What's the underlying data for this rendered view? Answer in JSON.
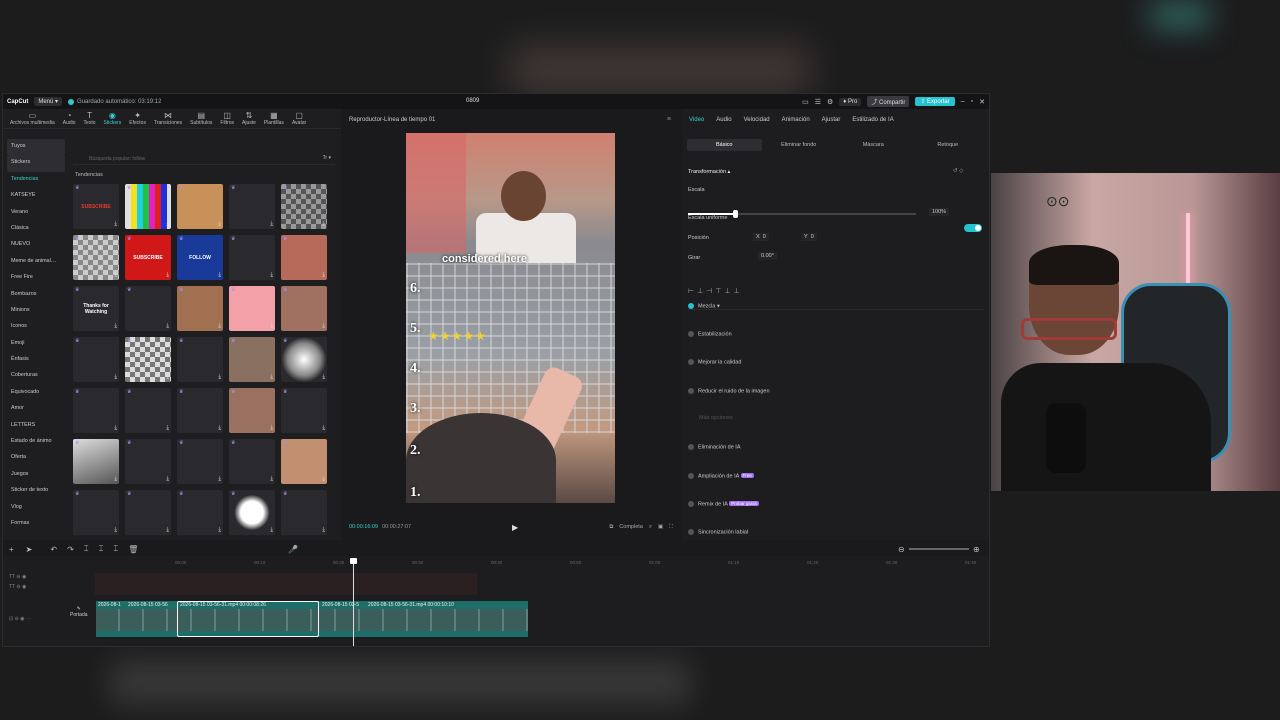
{
  "app": {
    "logo": "CapCut",
    "menu": "Menú",
    "autosave": "Guardado automático: 03:19:12",
    "project": "0809",
    "pro": "Pro",
    "share": "Compartir",
    "export": "Exportar"
  },
  "left": {
    "categories": [
      {
        "label": "Archivos multimedia",
        "icon": "▭"
      },
      {
        "label": "Audio",
        "icon": "◔"
      },
      {
        "label": "Texto",
        "icon": "T"
      },
      {
        "label": "Stickers",
        "icon": "◉"
      },
      {
        "label": "Efectos",
        "icon": "✦"
      },
      {
        "label": "Transiciones",
        "icon": "⋈"
      },
      {
        "label": "Subtítulos",
        "icon": "▤"
      },
      {
        "label": "Filtros",
        "icon": "◫"
      },
      {
        "label": "Ajuste",
        "icon": "⇅"
      },
      {
        "label": "Plantillas",
        "icon": "▦"
      },
      {
        "label": "Avatar",
        "icon": "▢"
      }
    ],
    "sidebar": [
      "Tuyos",
      "Stickers",
      "Tendencias",
      "KATSEYE",
      "Verano",
      "Clásica",
      "NUEVO",
      "Meme de animal…",
      "Free Fire",
      "Bombazos",
      "Minions",
      "Iconos",
      "Emoji",
      "Énfasis",
      "Coberturas",
      "Equivocado",
      "Amor",
      "LETTERS",
      "Estado de ánimo",
      "Oferta",
      "Juegos",
      "Sticker de texto",
      "Vlog",
      "Formas"
    ],
    "search_placeholder": "Búsqueda popular: follow",
    "section": "Tendencias",
    "tiles": [
      {
        "text": "SUBSCRIBE",
        "bg": "#2a2a2e",
        "fg": "#e53935"
      },
      {
        "text": "",
        "bg": "repeating-linear-gradient(90deg,#e0e0e0 0 6px,#f0e020 6px 12px,#20d0e0 12px 18px,#20c040 18px 24px,#e020c0 24px 30px,#e02020 30px 36px,#2030e0 36px 42px)",
        "fg": "#fff"
      },
      {
        "text": "",
        "bg": "#c8915a",
        "fg": "#fff"
      },
      {
        "text": "",
        "bg": "#2a2a2e",
        "fg": "#d00"
      },
      {
        "text": "",
        "bg": "repeating-conic-gradient(#555 0 25%,#999 0 50%) 0 0/10px 10px",
        "fg": "#fff"
      },
      {
        "text": "",
        "bg": "repeating-conic-gradient(#ccc 0 25%,#888 0 50%) 0 0/10px 10px",
        "fg": "#fff"
      },
      {
        "text": "SUBSCRIBE",
        "bg": "#d01818",
        "fg": "#fff"
      },
      {
        "text": "FOLLOW",
        "bg": "#1a3a9a",
        "fg": "#fff"
      },
      {
        "text": "",
        "bg": "#2a2a2e",
        "fg": "#e0a020"
      },
      {
        "text": "",
        "bg": "#b86a5a",
        "fg": "#fff"
      },
      {
        "text": "Thanks for Watching",
        "bg": "#2a2a2e",
        "fg": "#fff"
      },
      {
        "text": "",
        "bg": "#2a2a2e",
        "fg": "#ddd"
      },
      {
        "text": "",
        "bg": "#a07050",
        "fg": "#fff"
      },
      {
        "text": "",
        "bg": "#f4a0a8",
        "fg": "#fff"
      },
      {
        "text": "",
        "bg": "#a07060",
        "fg": "#fff"
      },
      {
        "text": "",
        "bg": "#2a2a2e",
        "fg": "#b07a40"
      },
      {
        "text": "",
        "bg": "repeating-conic-gradient(#ddd 0 25%,#777 0 50%) 0 0/10px 10px",
        "fg": "#fff"
      },
      {
        "text": "",
        "bg": "#2a2a2e",
        "fg": "#eee"
      },
      {
        "text": "",
        "bg": "#8a7060",
        "fg": "#fff"
      },
      {
        "text": "",
        "bg": "radial-gradient(circle,#fff 0%,#888 50%,#2a2a2e 70%)",
        "fg": "#fff"
      },
      {
        "text": "",
        "bg": "#2a2a2e",
        "fg": "#fff"
      },
      {
        "text": "",
        "bg": "#2a2a2e",
        "fg": "#e060a0"
      },
      {
        "text": "",
        "bg": "#2a2a2e",
        "fg": "#ccc"
      },
      {
        "text": "",
        "bg": "#9a7060",
        "fg": "#fff"
      },
      {
        "text": "",
        "bg": "#2a2a2e",
        "fg": "#fff"
      },
      {
        "text": "",
        "bg": "linear-gradient(160deg,#ddd,#555)",
        "fg": "#fff"
      },
      {
        "text": "",
        "bg": "#2a2a2e",
        "fg": "#d04070"
      },
      {
        "text": "",
        "bg": "#2a2a2e",
        "fg": "#ddd"
      },
      {
        "text": "",
        "bg": "#2a2a2e",
        "fg": "#fff"
      },
      {
        "text": "",
        "bg": "#c09070",
        "fg": "#fff"
      },
      {
        "text": "",
        "bg": "#2a2a2e",
        "fg": "#f0a0b0"
      },
      {
        "text": "",
        "bg": "#2a2a2e",
        "fg": "#f07090"
      },
      {
        "text": "",
        "bg": "#2a2a2e",
        "fg": "#fff"
      },
      {
        "text": "",
        "bg": "radial-gradient(circle,#fff 0%,#fff 35%,#2a2a2e 55%)",
        "fg": "#fff"
      },
      {
        "text": "",
        "bg": "#2a2a2e",
        "fg": "#fff"
      }
    ]
  },
  "player": {
    "title": "Reproductor-Línea de tiempo 01",
    "caption": "considered here",
    "numbers": [
      "6.",
      "5.",
      "4.",
      "3.",
      "2.",
      "1."
    ],
    "stars": "★★★★★",
    "timecode": "00:00:16:09",
    "duration": "00:00:27:07",
    "full": "Completa"
  },
  "right": {
    "tabs": [
      "Video",
      "Audio",
      "Velocidad",
      "Animación",
      "Ajustar",
      "Estilizado de IA"
    ],
    "subtabs": [
      "Básico",
      "Eliminar fondo",
      "Máscara",
      "Retoque"
    ],
    "transform": "Transformación",
    "scale": "Escala",
    "scale_value": "100%",
    "uniform": "Escala uniforme",
    "position": "Posición",
    "pos_x": "0",
    "pos_y": "0",
    "rotate": "Girar",
    "rotate_value": "0.00°",
    "mix": "Mezcla",
    "stabilize": "Estabilización",
    "quality": "Mejorar la calidad",
    "noise": "Reducir el ruido de la imagen",
    "more": "Más opciones",
    "ai_remove": "Eliminación de IA",
    "ai_expand": "Ampliación de IA",
    "ai_remix": "Remix de IA",
    "lipsync": "Sincronización labial",
    "badge_free": "Free",
    "badge_try": "Probar gratis"
  },
  "timeline": {
    "ruler": [
      "00:00",
      "00:10",
      "00:20",
      "00:30",
      "00:40",
      "00:50",
      "01:00",
      "01:10",
      "01:20",
      "01:30",
      "01:40"
    ],
    "clips": [
      "2026-08-1",
      "2026-08-15 03-56",
      "2026-08-15 03-56-31.mp4  00:00:08:26",
      "2026-08-15 03-5",
      "2026-08-15 03-56-31.mp4  00:00:10:10"
    ],
    "cover": "Portada"
  }
}
